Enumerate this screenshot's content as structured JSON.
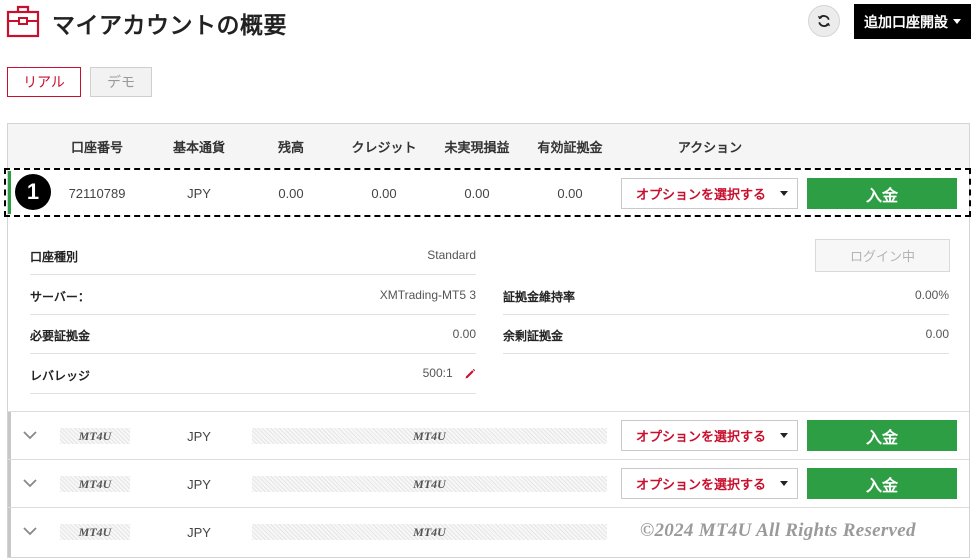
{
  "header": {
    "title": "マイアカウントの概要",
    "add_account_label": "追加口座開設",
    "icons": {
      "page": "briefcase-icon",
      "refresh": "refresh-icon"
    }
  },
  "tabs": [
    {
      "label": "リアル",
      "active": true
    },
    {
      "label": "デモ",
      "active": false
    }
  ],
  "table": {
    "columns": [
      "口座番号",
      "基本通貨",
      "残高",
      "クレジット",
      "未実現損益",
      "有効証拠金",
      "アクション"
    ],
    "expanded_row": {
      "badge": "1",
      "account_number": "72110789",
      "currency": "JPY",
      "balance": "0.00",
      "credit": "0.00",
      "unrealized_pl": "0.00",
      "equity": "0.00",
      "action_select": "オプションを選択する",
      "deposit_label": "入金"
    },
    "details": {
      "account_type_label": "口座種別",
      "account_type_value": "Standard",
      "server_label": "サーバー：",
      "server_value": "XMTrading-MT5 3",
      "required_margin_label": "必要証拠金",
      "required_margin_value": "0.00",
      "leverage_label": "レバレッジ",
      "leverage_value": "500:1",
      "login_button_label": "ログイン中",
      "margin_level_label": "証拠金維持率",
      "margin_level_value": "0.00%",
      "free_margin_label": "余剰証拠金",
      "free_margin_value": "0.00"
    },
    "collapsed_rows": [
      {
        "masked_account": "MT4U",
        "currency": "JPY",
        "masked_values": "MT4U",
        "action_select": "オプションを選択する",
        "deposit_label": "入金"
      },
      {
        "masked_account": "MT4U",
        "currency": "JPY",
        "masked_values": "MT4U",
        "action_select": "オプションを選択する",
        "deposit_label": "入金"
      },
      {
        "masked_account": "MT4U",
        "currency": "JPY",
        "masked_values": "MT4U"
      }
    ]
  },
  "watermark": "©2024 MT4U All Rights Reserved",
  "colors": {
    "brand_red": "#c8102e",
    "deposit_green": "#2e9e44",
    "black": "#000000"
  }
}
